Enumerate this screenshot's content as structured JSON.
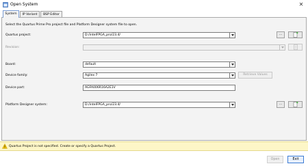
{
  "window": {
    "title": "Open System"
  },
  "tabs": [
    {
      "label": "System",
      "active": true
    },
    {
      "label": "IP Variant",
      "active": false
    },
    {
      "label": "BSP Editor",
      "active": false
    }
  ],
  "instruction": "Select the Quartus Prime Pro project file and Platform Designer system file to open.",
  "fields": {
    "quartus_project": {
      "label": "Quartus project:",
      "value": "D:/intelFPGA_pro/23.4/"
    },
    "revision": {
      "label": "Revision:",
      "value": ""
    },
    "board": {
      "label": "Board:",
      "value": "default"
    },
    "device_family": {
      "label": "Device family:",
      "value": "Agilex 7"
    },
    "device_part": {
      "label": "Device part:",
      "value": "AGFA006R16A2E1V"
    },
    "platform_designer": {
      "label": "Platform Designer system:",
      "value": "D:/intelFPGA_pro/23.4/"
    }
  },
  "buttons": {
    "browse": "...",
    "retrieve_values": "Retrieve Values",
    "open": "Open",
    "exit": "Exit"
  },
  "message": "Quartus Project is not specified. Create or specify a Quartus Project.",
  "colors": {
    "accent": "#3b7bd4",
    "new_icon": "#3aa835",
    "warning": "#f2c200",
    "message_bg": "#fdf6c7"
  }
}
